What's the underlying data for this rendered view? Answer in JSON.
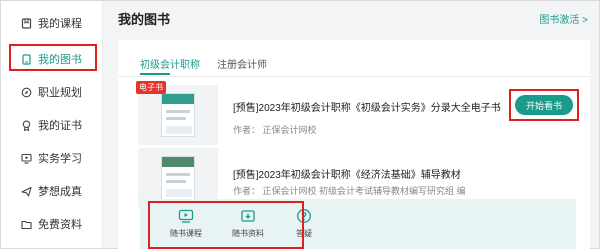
{
  "sidebar": {
    "items": [
      {
        "label": "我的课程",
        "icon": "bookmark-icon",
        "active": false
      },
      {
        "label": "我的图书",
        "icon": "book-icon",
        "active": true
      },
      {
        "label": "职业规划",
        "icon": "compass-icon",
        "active": false
      },
      {
        "label": "我的证书",
        "icon": "badge-icon",
        "active": false
      },
      {
        "label": "实务学习",
        "icon": "monitor-icon",
        "active": false
      },
      {
        "label": "梦想成真",
        "icon": "plane-icon",
        "active": false
      },
      {
        "label": "免费资料",
        "icon": "folder-icon",
        "active": false
      }
    ]
  },
  "header": {
    "title": "我的图书",
    "activate_link": "图书激活 >"
  },
  "tabs": [
    {
      "label": "初级会计职称",
      "active": true
    },
    {
      "label": "注册会计师",
      "active": false
    }
  ],
  "books": [
    {
      "tag": "电子书",
      "title": "[预售]2023年初级会计职称《初级会计实务》分录大全电子书",
      "author": "作者：  正保会计网校",
      "action": "开始看书"
    },
    {
      "title": "[预售]2023年初级会计职称《经济法基础》辅导教材",
      "author": "作者：  正保会计网校  初级会计考试辅导教材编写研究组 编"
    }
  ],
  "resources": [
    {
      "label": "随书课程",
      "icon": "video-icon"
    },
    {
      "label": "随书资料",
      "icon": "download-icon"
    },
    {
      "label": "答疑",
      "icon": "question-icon"
    }
  ],
  "colors": {
    "accent": "#1b9b8b",
    "highlight": "#e0201f",
    "tag": "#e4352b"
  }
}
